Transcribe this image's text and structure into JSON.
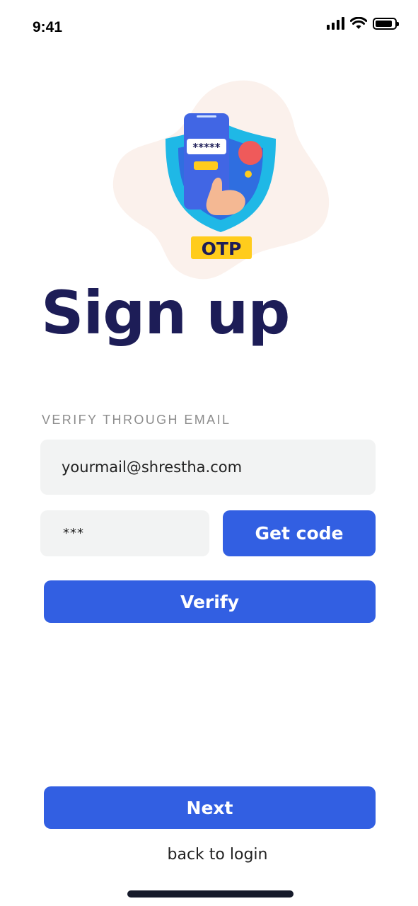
{
  "status_bar": {
    "time": "9:41",
    "icons": [
      "cellular-signal-icon",
      "wifi-icon",
      "battery-icon"
    ],
    "battery_level": 0.9
  },
  "illustration": {
    "badge_text": "OTP",
    "password_mask": "*****",
    "colors": {
      "blob": "#fbf1ec",
      "shield": "#1fb8e6",
      "phone": "#4166e4",
      "badge": "#ffcc1c",
      "badge_text": "#1d1d57",
      "dot_red": "#ef5a5a",
      "dot_yellow": "#ffcc1c",
      "hand": "#f4b893"
    }
  },
  "header": {
    "title": "Sign up"
  },
  "form": {
    "section_label": "VERIFY THROUGH EMAIL",
    "email_value": "yourmail@shrestha.com",
    "code_value": "***",
    "get_code_label": "Get code",
    "verify_label": "Verify"
  },
  "footer": {
    "next_label": "Next",
    "back_link": "back to login"
  },
  "colors": {
    "primary": "#325fe2",
    "title": "#1d1d57",
    "input_bg": "#f2f3f3",
    "label_gray": "#8d8d8d"
  }
}
